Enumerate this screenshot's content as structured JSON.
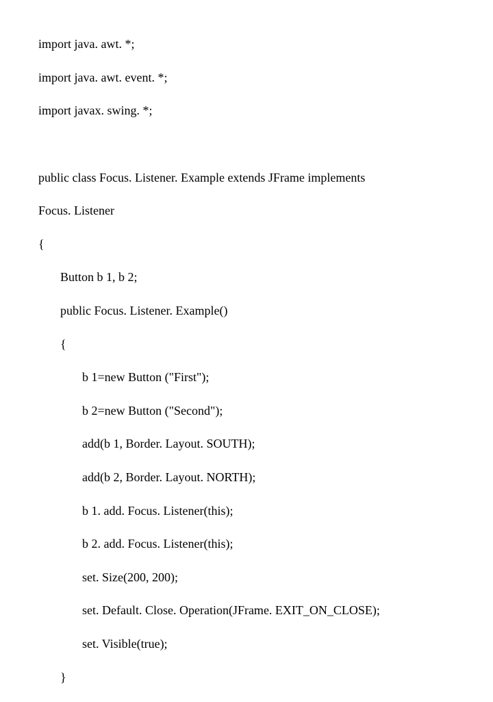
{
  "code": {
    "l1": "import java. awt. *;",
    "l2": "import java. awt. event. *;",
    "l3": "import javax. swing. *;",
    "blank1": " ",
    "l4": "public class Focus. Listener. Example extends JFrame implements",
    "l5": "Focus. Listener",
    "l6": "{",
    "l7": "Button b 1, b 2;",
    "l8": "public Focus. Listener. Example()",
    "l9": "{",
    "l10": "b 1=new Button (\"First\");",
    "l11": "b 2=new Button (\"Second\");",
    "l12": "add(b 1, Border. Layout. SOUTH);",
    "l13": "add(b 2, Border. Layout. NORTH);",
    "l14": "b 1. add. Focus. Listener(this);",
    "l15": "b 2. add. Focus. Listener(this);",
    "l16": "set. Size(200, 200);",
    "l17": "set. Default. Close. Operation(JFrame. EXIT_ON_CLOSE);",
    "l18": "set. Visible(true);",
    "l19": "}"
  }
}
